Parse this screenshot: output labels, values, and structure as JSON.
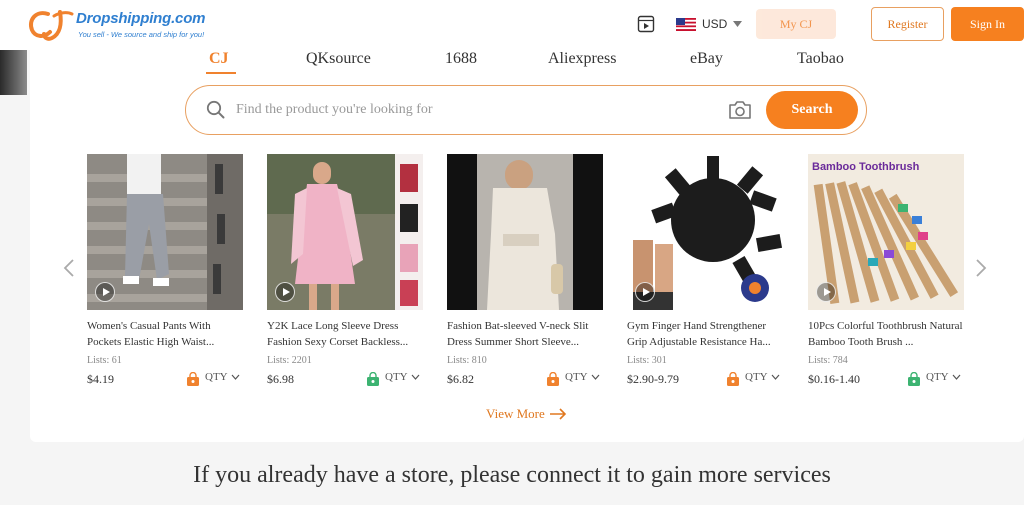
{
  "header": {
    "logo_name": "Dropshipping.com",
    "logo_tagline": "You sell - We source and ship for you!",
    "currency": "USD",
    "my_cj": "My CJ",
    "register": "Register",
    "sign_in": "Sign In"
  },
  "tabs": [
    {
      "label": "CJ",
      "active": true
    },
    {
      "label": "QKsource",
      "active": false
    },
    {
      "label": "1688",
      "active": false
    },
    {
      "label": "Aliexpress",
      "active": false
    },
    {
      "label": "eBay",
      "active": false
    },
    {
      "label": "Taobao",
      "active": false
    }
  ],
  "search": {
    "placeholder": "Find the product you're looking for",
    "button": "Search"
  },
  "products": [
    {
      "title": "Women's Casual Pants With Pockets Elastic High Waist...",
      "lists": "Lists: 61",
      "price": "$4.19",
      "qty": "QTY",
      "badge": "orange"
    },
    {
      "title": "Y2K Lace Long Sleeve Dress Fashion Sexy Corset Backless...",
      "lists": "Lists: 2201",
      "price": "$6.98",
      "qty": "QTY",
      "badge": "green"
    },
    {
      "title": "Fashion Bat-sleeved V-neck Slit Dress Summer Short Sleeve...",
      "lists": "Lists: 810",
      "price": "$6.82",
      "qty": "QTY",
      "badge": "orange"
    },
    {
      "title": "Gym Finger Hand Strengthener Grip Adjustable Resistance Ha...",
      "lists": "Lists: 301",
      "price": "$2.90-9.79",
      "qty": "QTY",
      "badge": "orange"
    },
    {
      "title": "10Pcs Colorful Toothbrush Natural Bamboo Tooth Brush ...",
      "lists": "Lists: 784",
      "price": "$0.16-1.40",
      "qty": "QTY",
      "badge": "green",
      "image_caption": "Bamboo Toothbrush"
    }
  ],
  "view_more": "View More",
  "connect_text": "If you already have a store, please connect it to gain more services",
  "colors": {
    "accent": "#f6801f",
    "brand_blue": "#2f7fd0"
  }
}
